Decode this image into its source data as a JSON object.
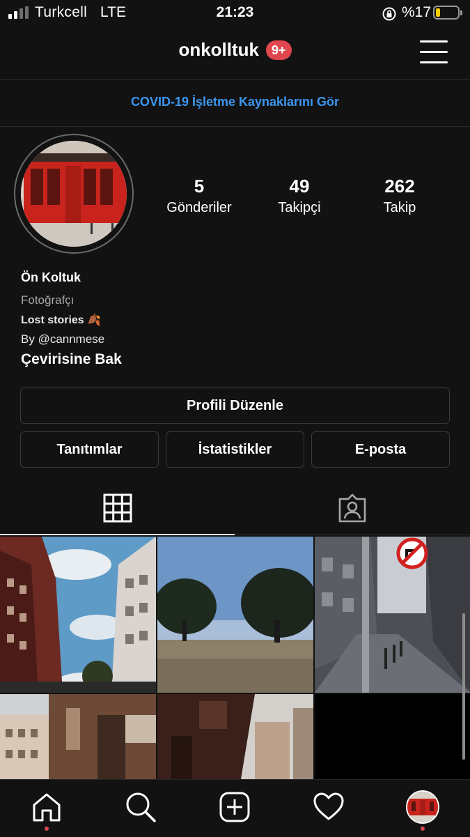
{
  "status_bar": {
    "carrier": "Turkcell",
    "network": "LTE",
    "time": "21:23",
    "battery_percent": "%17",
    "battery_level": 0.17,
    "battery_color": "#ffcc00"
  },
  "header": {
    "username": "onkolltuk",
    "notification_badge": "9+",
    "badge_color": "#e0464e"
  },
  "covid_banner": {
    "text": "COVID-19 İşletme Kaynaklarını Gör",
    "color": "#3b97f0"
  },
  "profile": {
    "stats": [
      {
        "value": "5",
        "label": "Gönderiler"
      },
      {
        "value": "49",
        "label": "Takipçi"
      },
      {
        "value": "262",
        "label": "Takip"
      }
    ],
    "display_name": "Ön Koltuk",
    "category": "Fotoğrafçı",
    "bio_line_1": "Lost stories 🍂",
    "bio_line_2": "By @cannmese",
    "translate_link": "Çevirisine Bak"
  },
  "actions": {
    "edit_profile": "Profili Düzenle",
    "promotions": "Tanıtımlar",
    "insights": "İstatistikler",
    "email": "E-posta"
  },
  "tabs": [
    {
      "icon": "grid-icon",
      "selected": true
    },
    {
      "icon": "tagged-person-icon",
      "selected": false
    }
  ],
  "posts_count_shown": 5,
  "bottom_nav": [
    {
      "icon": "home-icon",
      "active": true
    },
    {
      "icon": "search-icon",
      "active": false
    },
    {
      "icon": "add-post-icon",
      "active": false
    },
    {
      "icon": "heart-icon",
      "active": false
    },
    {
      "icon": "profile-avatar",
      "active": false
    }
  ]
}
